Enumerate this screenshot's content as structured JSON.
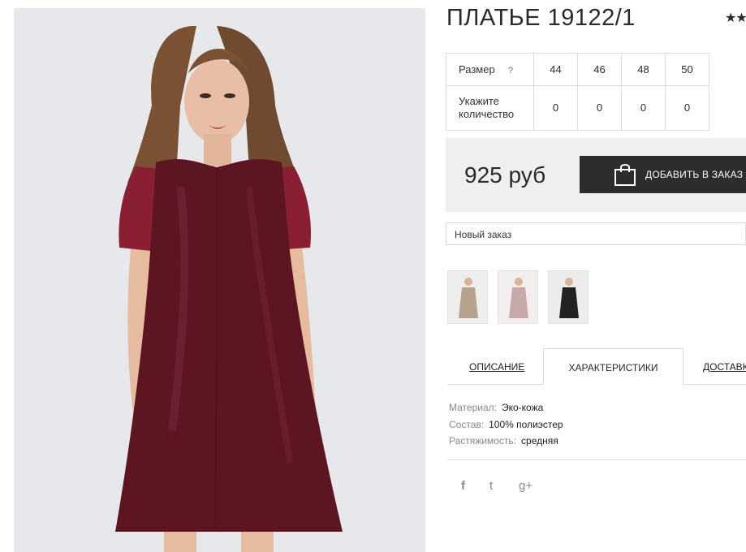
{
  "product": {
    "title": "ПЛАТЬЕ 19122/1",
    "rating_stars": "★★"
  },
  "sizes": {
    "size_label": "Размер",
    "help": "?",
    "values": [
      "44",
      "46",
      "48",
      "50"
    ],
    "qty_label_line1": "Укажите",
    "qty_label_line2": "количество",
    "quantities": [
      "0",
      "0",
      "0",
      "0"
    ]
  },
  "price": {
    "amount": "925 руб",
    "add_button": "ДОБАВИТЬ В ЗАКАЗ"
  },
  "order_select": {
    "value": "Новый заказ"
  },
  "thumbnails": [
    "beige-dress",
    "pink-dress",
    "black-dress"
  ],
  "tabs": [
    {
      "label": "ОПИСАНИЕ"
    },
    {
      "label": "ХАРАКТЕРИСТИКИ"
    },
    {
      "label": "ДОСТАВКА"
    }
  ],
  "specs": [
    {
      "key": "Материал:",
      "value": "Эко-кожа"
    },
    {
      "key": "Состав:",
      "value": "100% полиэстер"
    },
    {
      "key": "Растяжимость:",
      "value": "средняя"
    }
  ],
  "social": {
    "facebook": "f",
    "twitter": "t",
    "googleplus": "g+"
  },
  "colors": {
    "dress": "#5e1522",
    "button": "#2d2d2d",
    "price_bg": "#efefef",
    "photo_bg": "#e7e8ec"
  }
}
